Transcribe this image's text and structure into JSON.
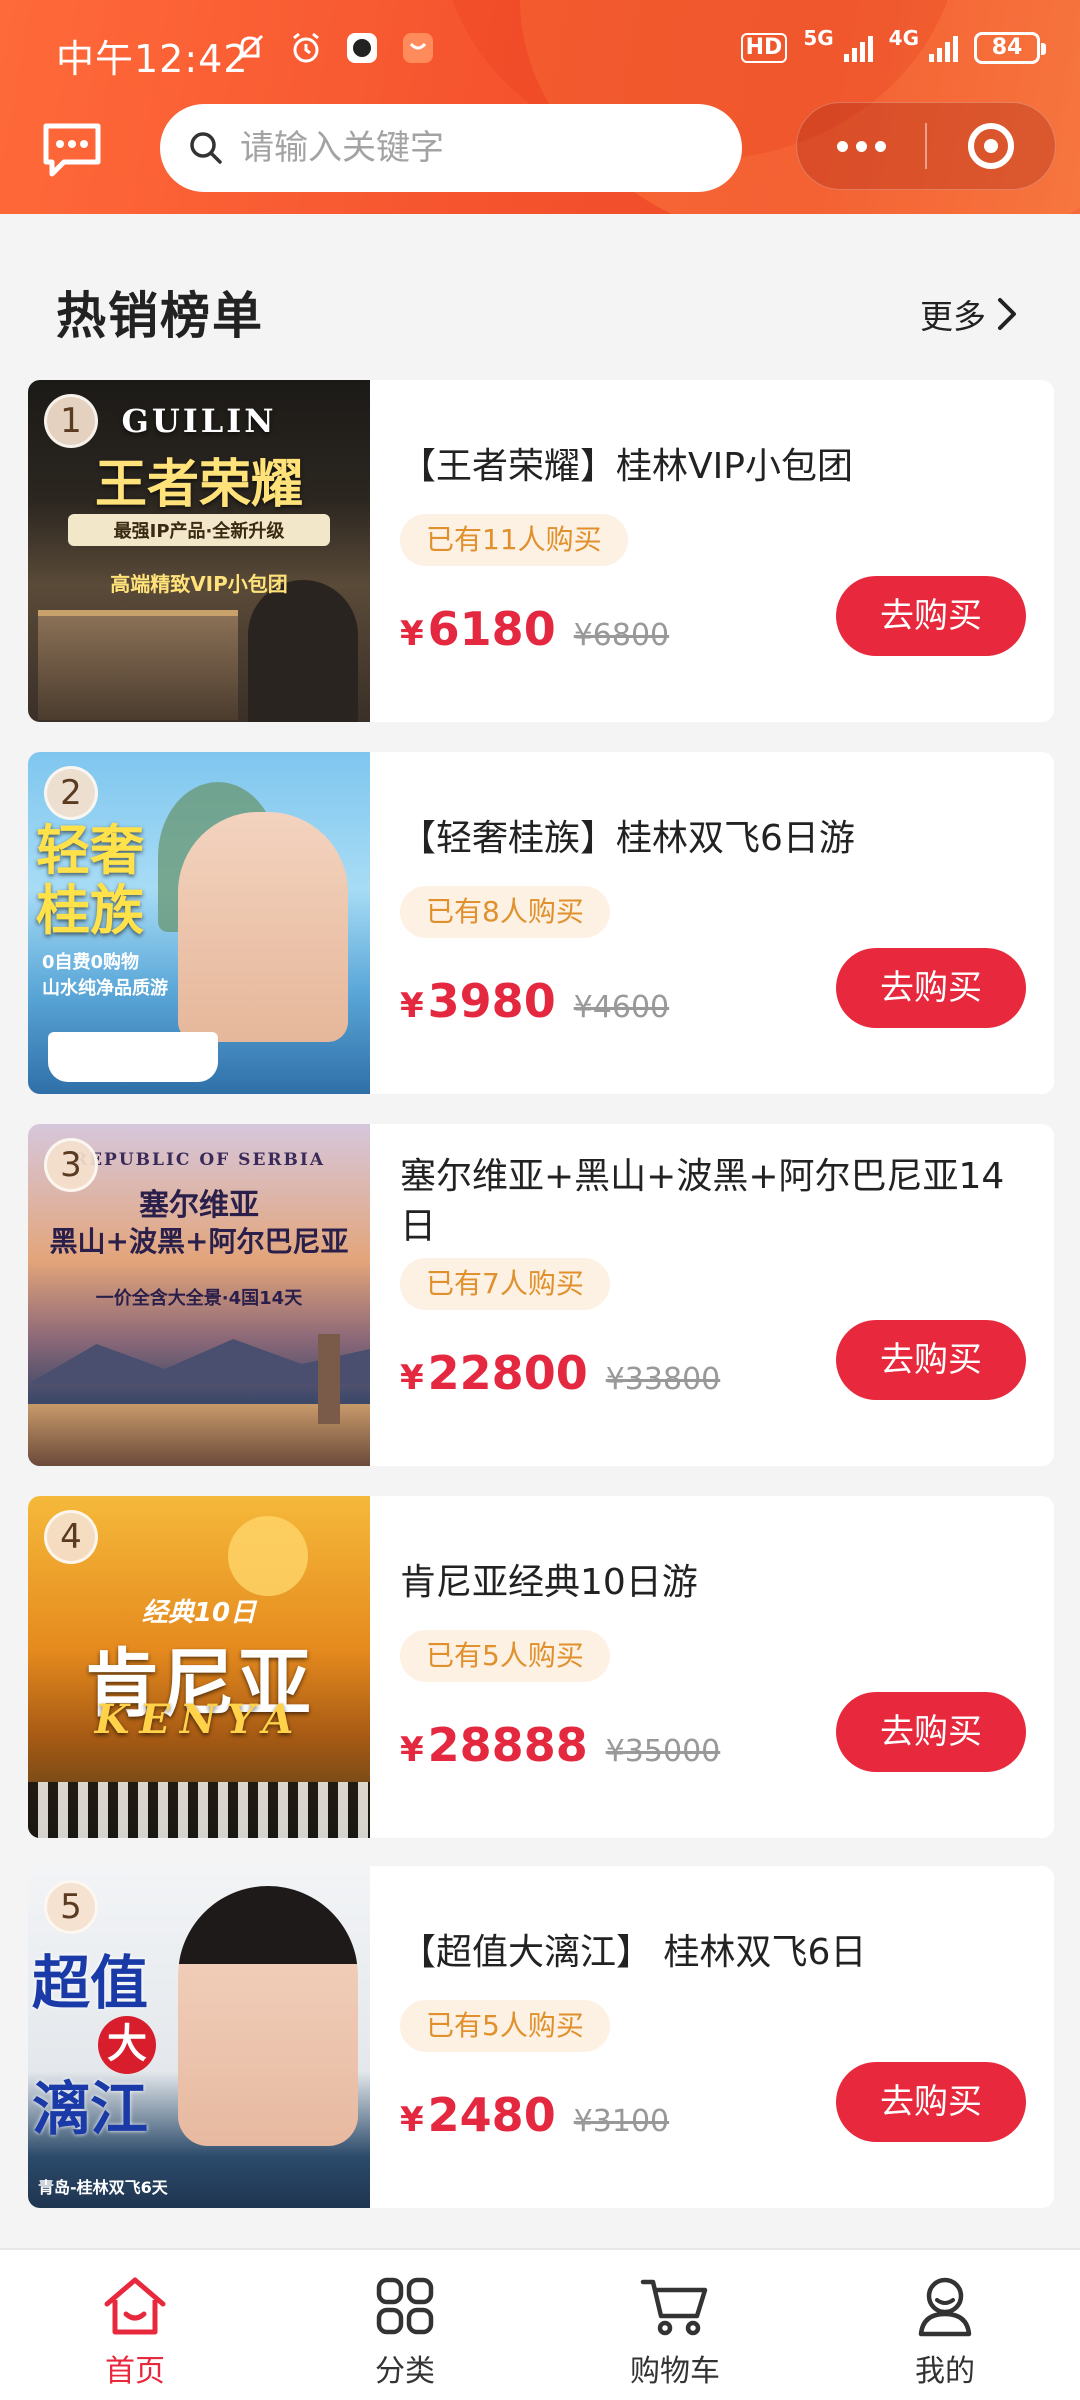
{
  "status_bar": {
    "time": "中午12:42",
    "hd": "HD",
    "net1": "5G",
    "net2": "4G",
    "battery": "84"
  },
  "header": {
    "search_placeholder": "请输入关键字"
  },
  "section": {
    "title": "热销榜单",
    "more": "更多"
  },
  "products": [
    {
      "rank": "1",
      "title": "【王者荣耀】桂林VIP小包团",
      "sold": "已有11人购买",
      "currency": "¥",
      "price": "6180",
      "original": "¥6800",
      "buy": "去购买",
      "img_line1": "GUILIN",
      "img_line2": "王者荣耀",
      "img_line3": "最强IP产品·全新升级",
      "img_line4": "高端精致VIP小包团"
    },
    {
      "rank": "2",
      "title": "【轻奢桂族】桂林双飞6日游",
      "sold": "已有8人购买",
      "currency": "¥",
      "price": "3980",
      "original": "¥4600",
      "buy": "去购买",
      "img_line1": "轻奢",
      "img_line2": "桂族",
      "img_line3": "0自费0购物",
      "img_line4": "山水纯净品质游"
    },
    {
      "rank": "3",
      "title": "塞尔维亚+黑山+波黑+阿尔巴尼亚14日",
      "sold": "已有7人购买",
      "currency": "¥",
      "price": "22800",
      "original": "¥33800",
      "buy": "去购买",
      "img_line1": "REPUBLIC OF SERBIA",
      "img_line2": "塞尔维亚",
      "img_line3": "黑山+波黑+阿尔巴尼亚",
      "img_line4": "一价全含大全景·4国14天"
    },
    {
      "rank": "4",
      "title": "肯尼亚经典10日游",
      "sold": "已有5人购买",
      "currency": "¥",
      "price": "28888",
      "original": "¥35000",
      "buy": "去购买",
      "img_line1": "经典10日",
      "img_line2": "肯尼亚",
      "img_line3": "KENYA"
    },
    {
      "rank": "5",
      "title": "【超值大漓江】 桂林双飞6日",
      "sold": "已有5人购买",
      "currency": "¥",
      "price": "2480",
      "original": "¥3100",
      "buy": "去购买",
      "img_line1": "超值",
      "img_line2": "大",
      "img_line3": "漓江",
      "img_line4": "青岛-桂林双飞6天"
    }
  ],
  "tabbar": [
    {
      "label": "首页",
      "icon": "home-icon",
      "active": true
    },
    {
      "label": "分类",
      "icon": "grid-icon",
      "active": false
    },
    {
      "label": "购物车",
      "icon": "cart-icon",
      "active": false
    },
    {
      "label": "我的",
      "icon": "user-icon",
      "active": false
    }
  ],
  "colors": {
    "accent": "#e8283c",
    "header": "#f5542e",
    "badge_bg": "#fdf1e3",
    "badge_text": "#e0902c"
  }
}
